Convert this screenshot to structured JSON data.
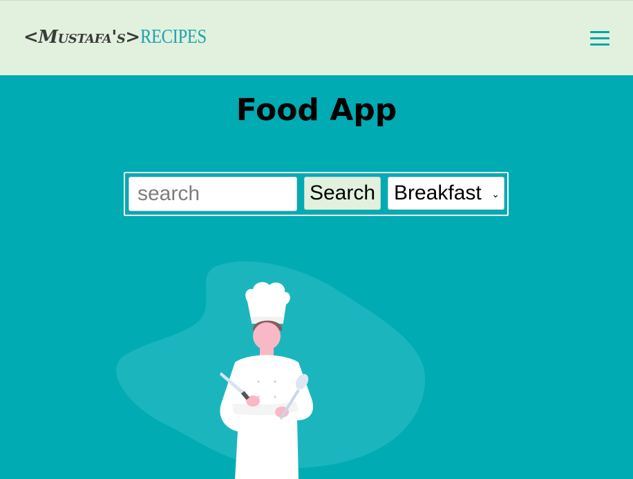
{
  "navbar": {
    "logo_name": "<Mustafa's>",
    "logo_accent": "RECIPES",
    "menu_icon": "hamburger-menu-icon"
  },
  "main": {
    "title": "Food App"
  },
  "search": {
    "placeholder": "search",
    "value": "",
    "button_label": "Search",
    "category_selected": "Breakfast",
    "dropdown_icon": "chevron-down-icon"
  },
  "hero": {
    "illustration": "chef-illustration"
  },
  "colors": {
    "background": "#00abb3",
    "navbar": "#e2f0de",
    "accent": "#1aa4ad",
    "blob": "#1bb6bd"
  }
}
